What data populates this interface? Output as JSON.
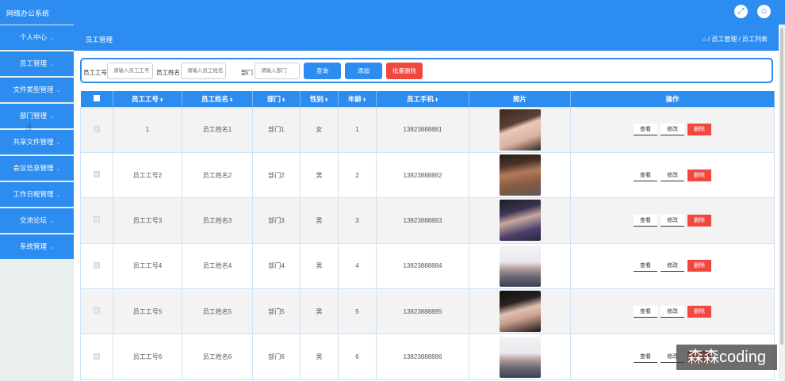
{
  "app": {
    "title": "网络办公系统"
  },
  "topbar_icons": [
    "expand-icon",
    "user-icon"
  ],
  "sidebar": {
    "items": [
      {
        "label": "个人中心"
      },
      {
        "label": "员工管理"
      },
      {
        "label": "文件类型管理"
      },
      {
        "label": "部门管理"
      },
      {
        "label": "共享文件管理"
      },
      {
        "label": "会议信息管理"
      },
      {
        "label": "工作日程管理"
      },
      {
        "label": "交流论坛"
      },
      {
        "label": "系统管理"
      }
    ]
  },
  "header": {
    "page_title": "员工管理",
    "breadcrumb": "⌂ / 员工管理 / 员工列表"
  },
  "search": {
    "emp_no_label": "员工工号",
    "emp_no_placeholder": "请输入员工工号",
    "emp_name_label": "员工姓名",
    "emp_name_placeholder": "请输入员工姓名",
    "dept_label": "部门",
    "dept_placeholder": "请输入部门",
    "query_button": "查询",
    "add_button": "添加",
    "batch_delete_button": "批量删除"
  },
  "table": {
    "headers": [
      "员工工号",
      "员工姓名",
      "部门",
      "性别",
      "年龄",
      "员工手机",
      "照片",
      "操作"
    ],
    "rows": [
      {
        "emp_no": "1",
        "name": "员工姓名1",
        "dept": "部门1",
        "gender": "女",
        "age": "1",
        "phone": "13823888881"
      },
      {
        "emp_no": "员工工号2",
        "name": "员工姓名2",
        "dept": "部门2",
        "gender": "男",
        "age": "2",
        "phone": "13823888882"
      },
      {
        "emp_no": "员工工号3",
        "name": "员工姓名3",
        "dept": "部门3",
        "gender": "男",
        "age": "3",
        "phone": "13823888883"
      },
      {
        "emp_no": "员工工号4",
        "name": "员工姓名4",
        "dept": "部门4",
        "gender": "男",
        "age": "4",
        "phone": "13823888884"
      },
      {
        "emp_no": "员工工号5",
        "name": "员工姓名5",
        "dept": "部门5",
        "gender": "男",
        "age": "5",
        "phone": "13823888885"
      },
      {
        "emp_no": "员工工号6",
        "name": "员工姓名6",
        "dept": "部门6",
        "gender": "男",
        "age": "6",
        "phone": "13823888886"
      }
    ],
    "actions": {
      "view": "查看",
      "edit": "修改",
      "delete": "删除"
    }
  },
  "watermark": "森森coding",
  "colors": {
    "primary": "#2d8cf0",
    "danger": "#f0473f"
  }
}
